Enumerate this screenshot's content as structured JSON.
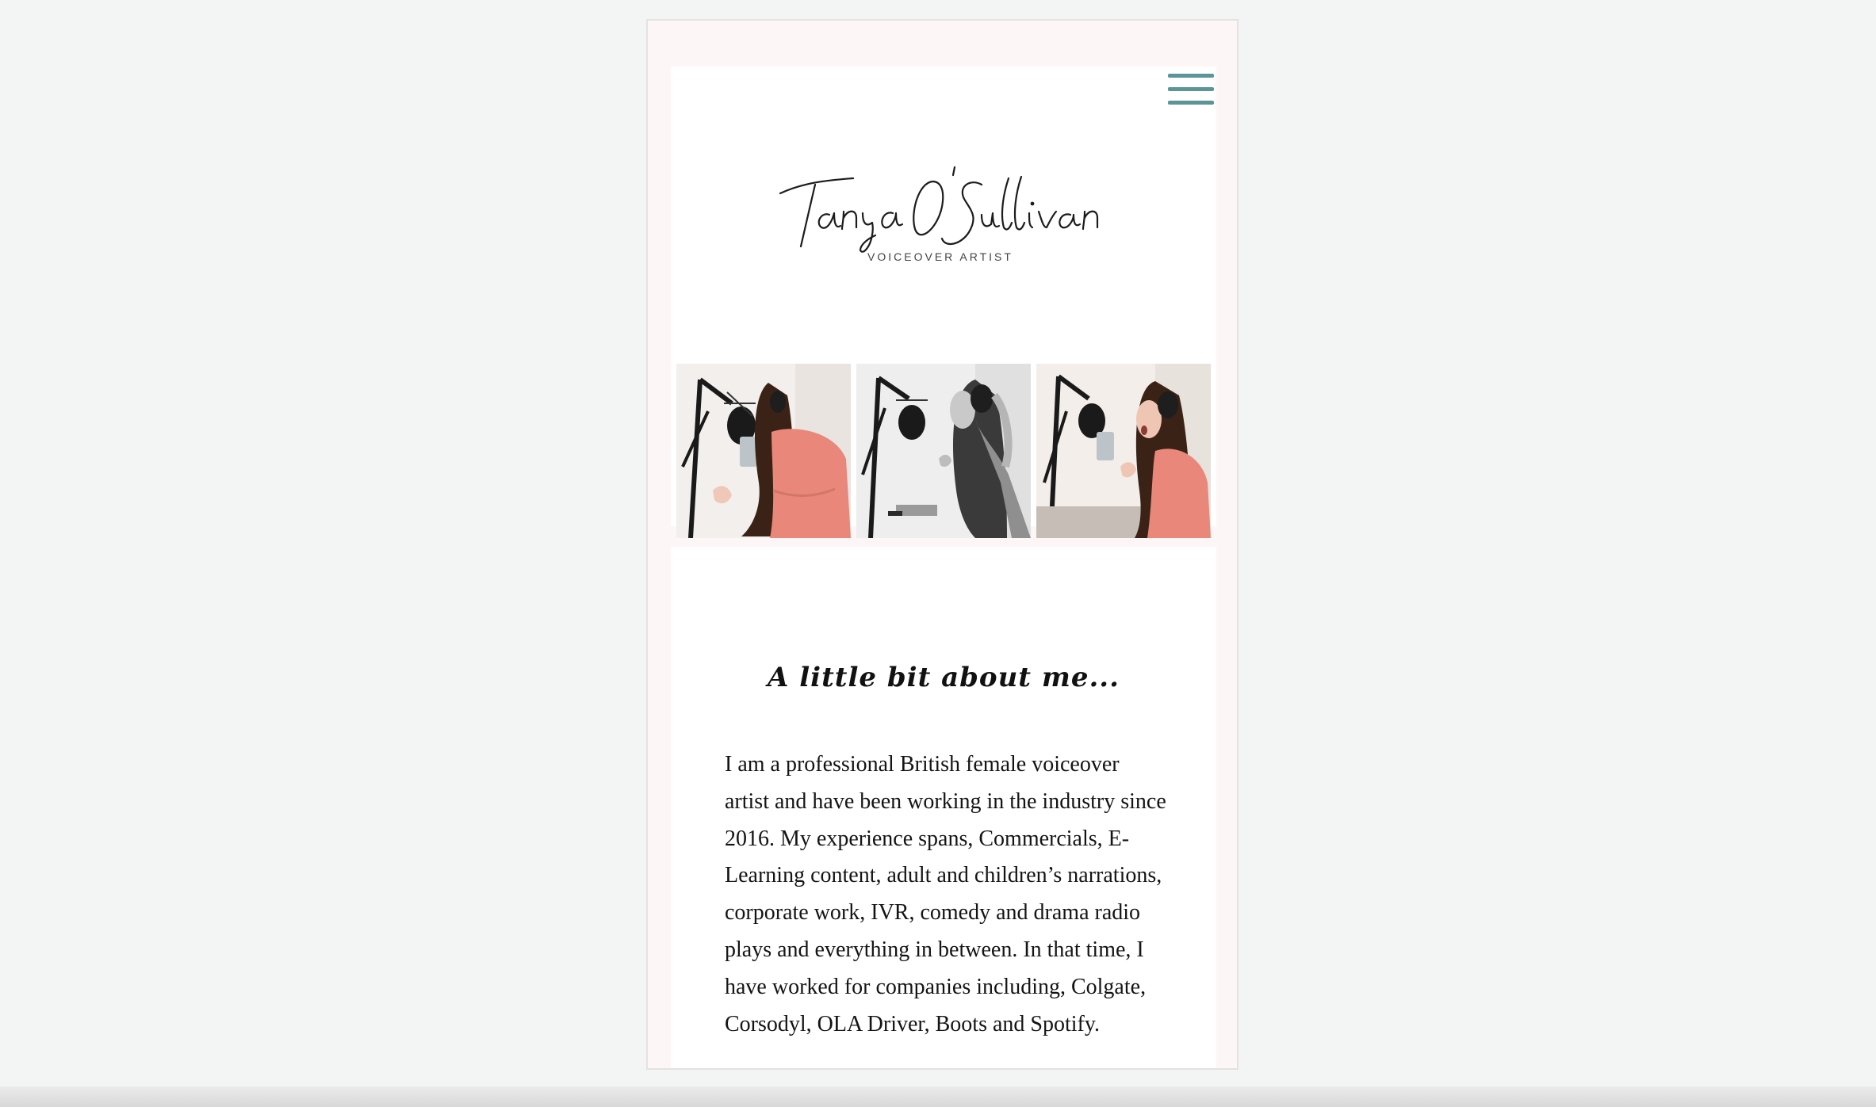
{
  "site": {
    "brand_name": "Tanya O'Sullivan",
    "brand_tagline": "VOICEOVER  ARTIST",
    "colors": {
      "accent": "#5c9597",
      "page_background": "#fdf6f6",
      "card_background": "#ffffff",
      "text": "#141414"
    }
  },
  "header": {
    "menu_icon": "hamburger-menu-icon"
  },
  "gallery": {
    "photos": [
      "studio-photo-1",
      "studio-photo-2",
      "studio-photo-3"
    ]
  },
  "about": {
    "heading": "A little bit about me...",
    "body": "I am a professional British female voiceover artist and have been working in the industry since 2016. My experience spans, Commercials, E-Learning content, adult and children’s narrations, corporate work, IVR, comedy and drama radio plays and everything in between. In that time, I have worked for companies including, Colgate, Corsodyl, OLA Driver, Boots and Spotify."
  }
}
